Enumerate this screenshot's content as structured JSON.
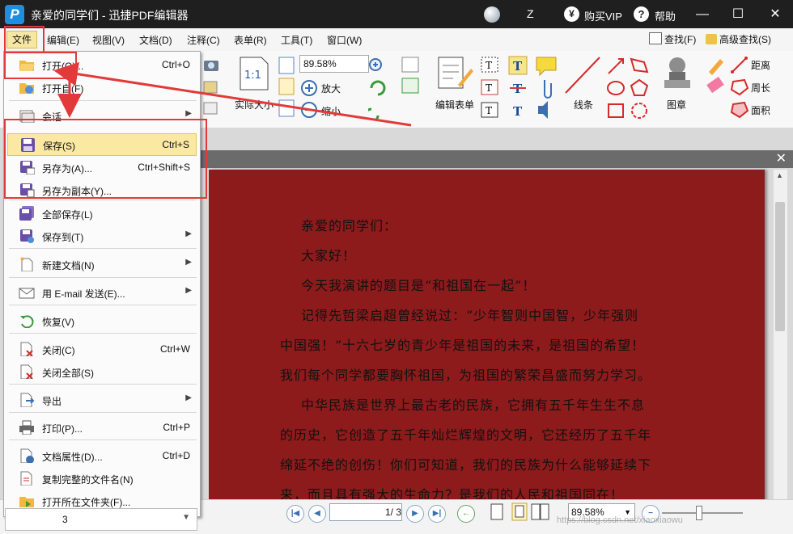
{
  "window": {
    "title": "亲爱的同学们 - 迅捷PDF编辑器",
    "user_initial": "Z",
    "vip_label": "购买VIP",
    "help_label": "帮助",
    "vip_icon": "¥",
    "help_icon": "?",
    "logo": "P"
  },
  "menubar": {
    "items": [
      "文件",
      "编辑(E)",
      "视图(V)",
      "文档(D)",
      "注释(C)",
      "表单(R)",
      "工具(T)",
      "窗口(W)"
    ],
    "find_label": "查找(F)",
    "advanced_find_label": "高级查找(S)"
  },
  "ribbon": {
    "zoom_value": "89.58%",
    "actual_size_icon_text": "1:1",
    "actual_size_label": "实际大小",
    "zoom_in_label": "放大",
    "zoom_out_label": "缩小",
    "edit_form_label": "编辑表单",
    "line_label": "线条",
    "stamp_label": "图章",
    "distance_label": "距离",
    "perimeter_label": "周长",
    "area_label": "面积"
  },
  "file_menu": {
    "items": [
      {
        "label": "打开(O)...",
        "shortcut": "Ctrl+O",
        "arrow": ""
      },
      {
        "label": "打开自(F)",
        "shortcut": "",
        "arrow": ""
      },
      {
        "label": "会话",
        "shortcut": "",
        "arrow": "▶"
      },
      {
        "label": "保存(S)",
        "shortcut": "Ctrl+S",
        "arrow": ""
      },
      {
        "label": "另存为(A)...",
        "shortcut": "Ctrl+Shift+S",
        "arrow": ""
      },
      {
        "label": "另存为副本(Y)...",
        "shortcut": "",
        "arrow": ""
      },
      {
        "label": "全部保存(L)",
        "shortcut": "",
        "arrow": ""
      },
      {
        "label": "保存到(T)",
        "shortcut": "",
        "arrow": "▶"
      },
      {
        "label": "新建文档(N)",
        "shortcut": "",
        "arrow": "▶"
      },
      {
        "label": "用 E-mail 发送(E)...",
        "shortcut": "",
        "arrow": "▶"
      },
      {
        "label": "恢复(V)",
        "shortcut": "",
        "arrow": ""
      },
      {
        "label": "关闭(C)",
        "shortcut": "Ctrl+W",
        "arrow": ""
      },
      {
        "label": "关闭全部(S)",
        "shortcut": "",
        "arrow": ""
      },
      {
        "label": "导出",
        "shortcut": "",
        "arrow": "▶"
      },
      {
        "label": "打印(P)...",
        "shortcut": "Ctrl+P",
        "arrow": ""
      },
      {
        "label": "文档属性(D)...",
        "shortcut": "Ctrl+D",
        "arrow": ""
      },
      {
        "label": "复制完整的文件名(N)",
        "shortcut": "",
        "arrow": ""
      },
      {
        "label": "打开所在文件夹(F)...",
        "shortcut": "",
        "arrow": ""
      }
    ],
    "highlighted": "保存(S)",
    "bottom_value": "3"
  },
  "document": {
    "lines": [
      "亲爱的同学们：",
      "大家好！",
      "今天我演讲的题目是“和祖国在一起”！",
      "记得先哲梁启超曾经说过：“少年智则中国智，少年强则",
      "中国强！”十六七岁的青少年是祖国的未来，是祖国的希望！",
      "我们每个同学都要胸怀祖国，为祖国的繁荣昌盛而努力学习。",
      "中华民族是世界上最古老的民族，它拥有五千年生生不息",
      "的历史，它创造了五千年灿烂辉煌的文明，它还经历了五千年",
      "绵延不绝的创伤！你们可知道，我们的民族为什么能够延续下",
      "来，而且具有强大的生命力？是我们的人民和祖国同在！"
    ],
    "page_bg": "#8d1b1b"
  },
  "statusbar": {
    "page_current": "1",
    "page_total": "/ 3",
    "zoom_value": "89.58%",
    "watermark": "https://blog.csdn.net/xiaoxiaowu"
  },
  "colors": {
    "titlebar": "#1f1f1f",
    "highlight": "#fbe9a3",
    "annotation_red": "#e23a3a"
  }
}
